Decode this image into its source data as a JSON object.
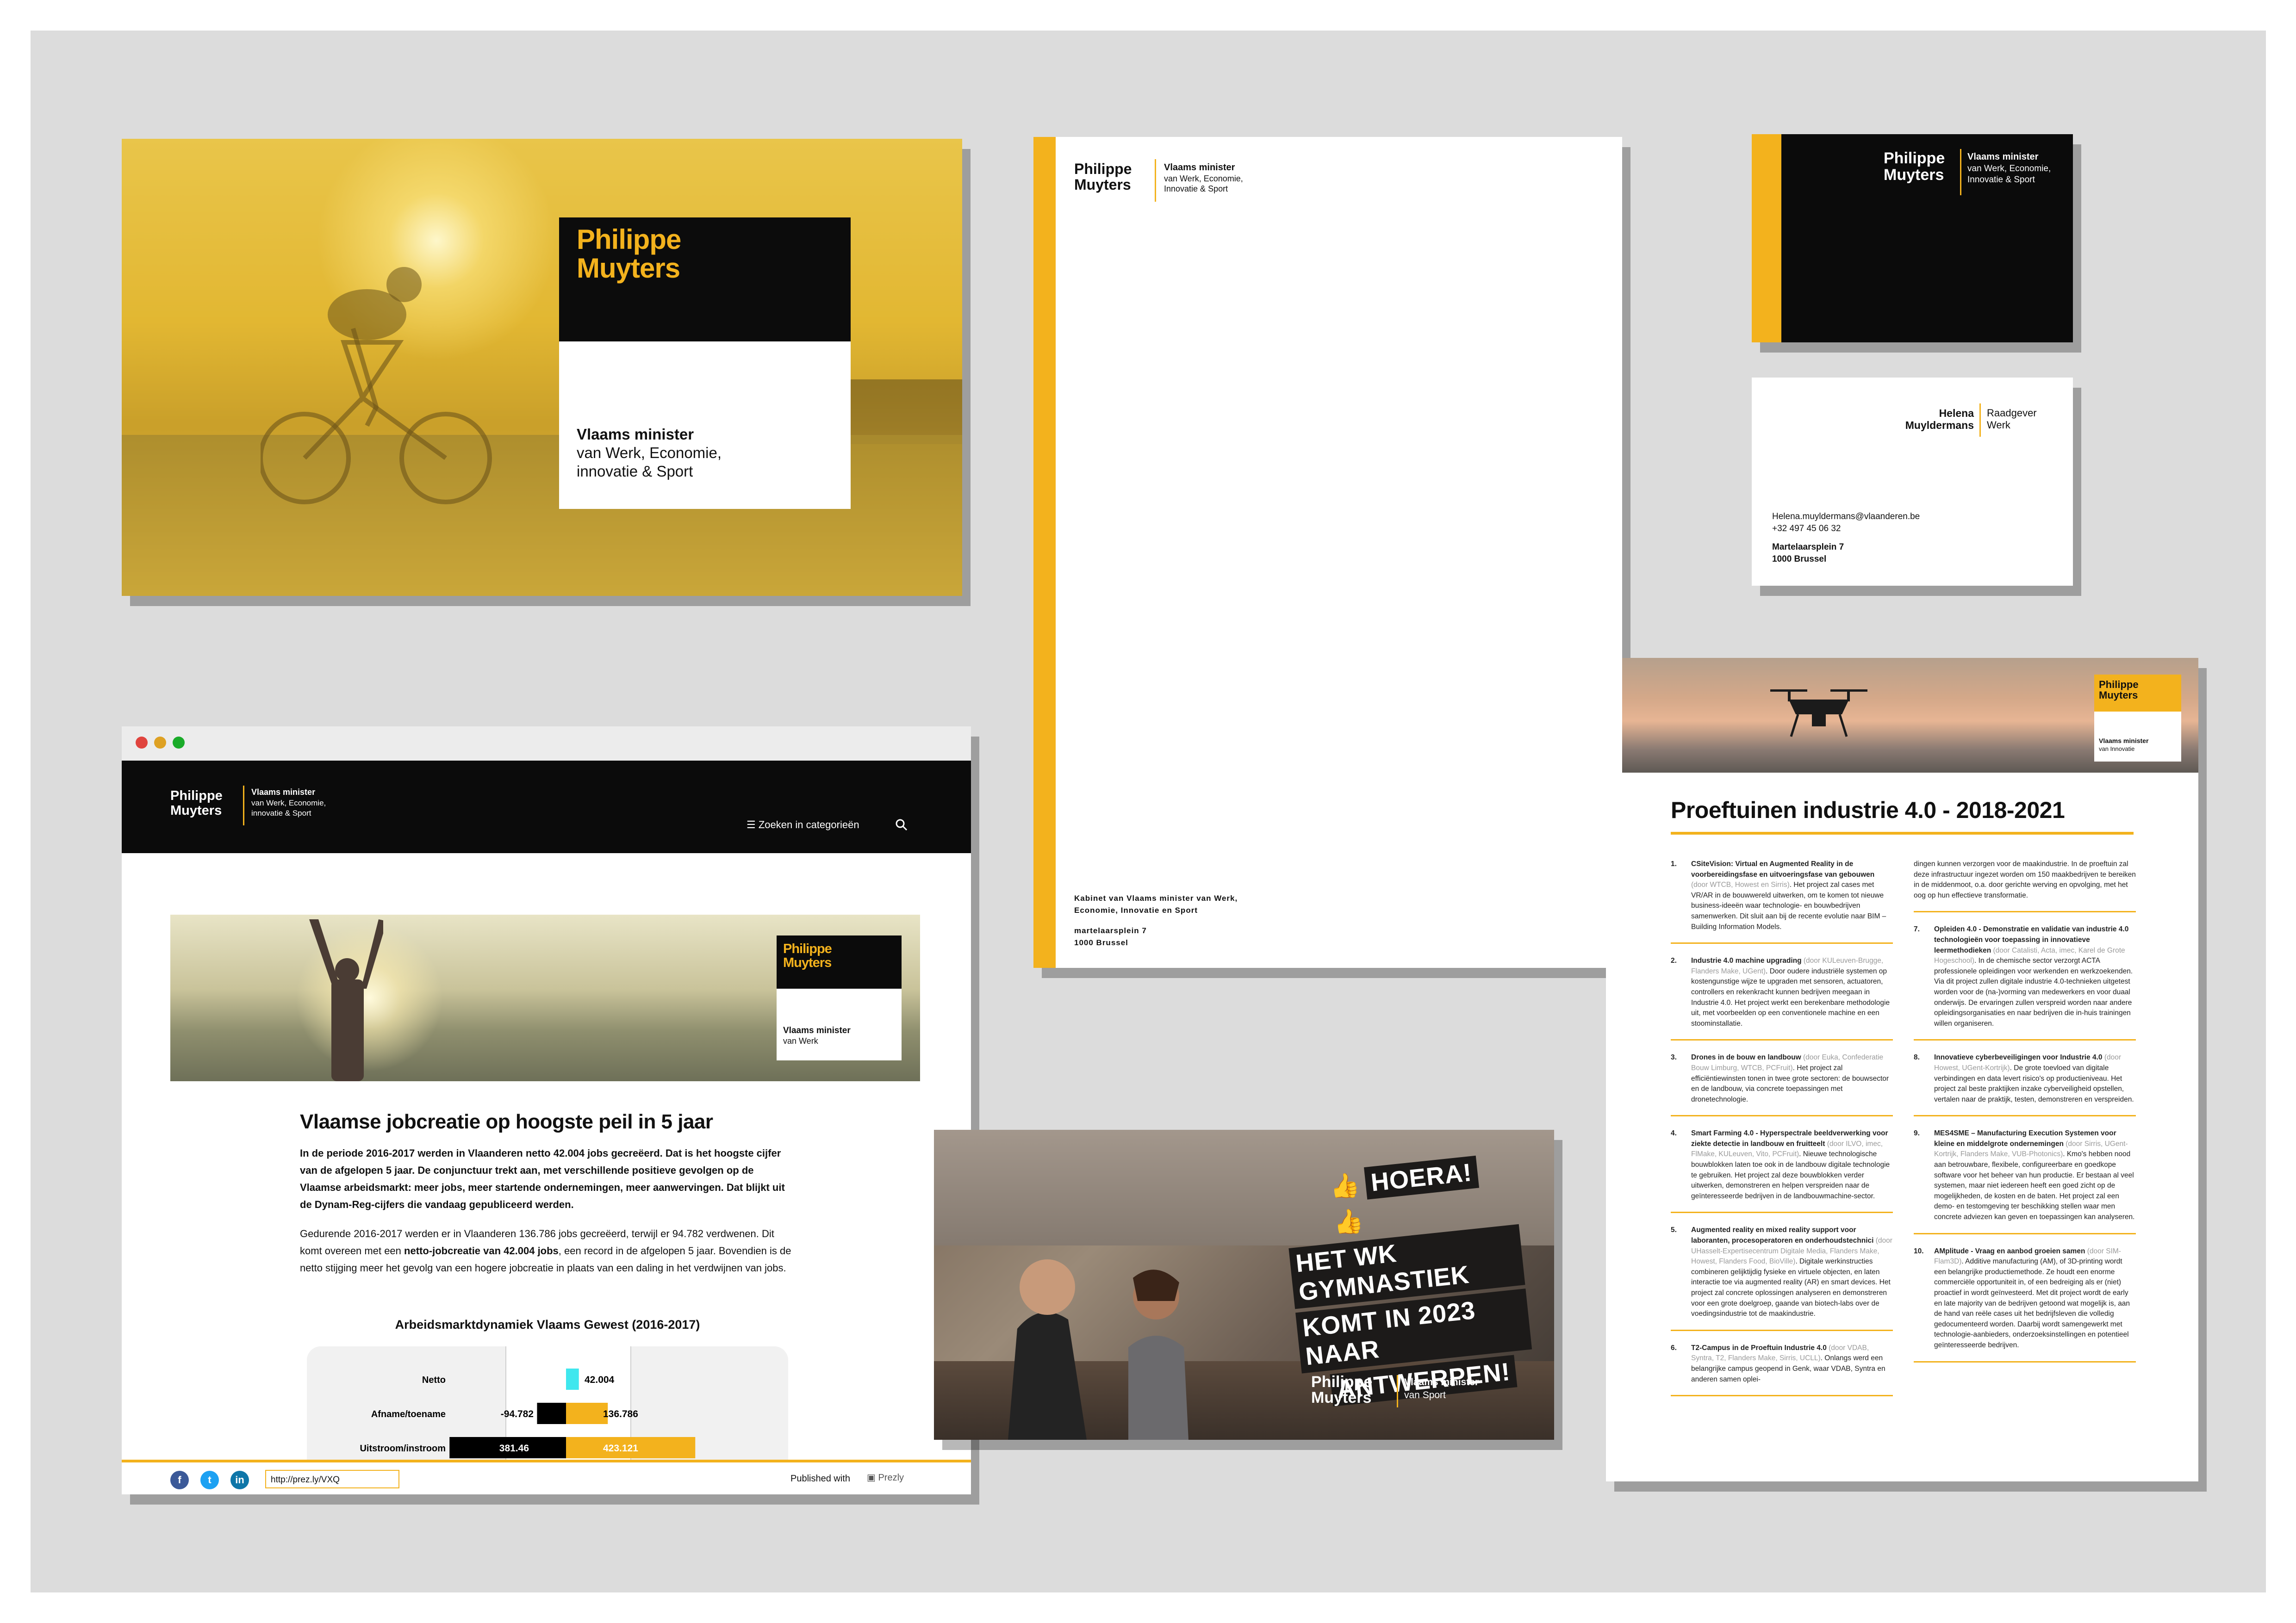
{
  "brand": {
    "name_line1": "Philippe",
    "name_line2": "Muyters",
    "accent": "#f3b21d",
    "black": "#0b0b0b"
  },
  "banner": {
    "title1": "Philippe",
    "title2": "Muyters",
    "role": "Vlaams minister",
    "sub1": "van Werk, Economie,",
    "sub2": "innovatie & Sport"
  },
  "letterhead": {
    "name1": "Philippe",
    "name2": "Muyters",
    "role": "Vlaams minister",
    "sub1": "van Werk, Economie,",
    "sub2": "Innovatie & Sport",
    "addr1": "Kabinet van Vlaams minister van Werk,",
    "addr2": "Economie, Innovatie en Sport",
    "addr3": "martelaarsplein 7",
    "addr4": "1000 Brussel"
  },
  "card_black": {
    "name1": "Philippe",
    "name2": "Muyters",
    "role": "Vlaams minister",
    "sub1": "van Werk, Economie,",
    "sub2": "Innovatie & Sport"
  },
  "card_white": {
    "name1": "Helena",
    "name2": "Muyldermans",
    "role1": "Raadgever",
    "role2": "Werk",
    "email": "Helena.muyldermans@vlaanderen.be",
    "phone": "+32 497 45 06 32",
    "addr1": "Martelaarsplein 7",
    "addr2": "1000 Brussel"
  },
  "browser": {
    "nav": {
      "name1": "Philippe",
      "name2": "Muyters",
      "role": "Vlaams minister",
      "sub1": "van Werk, Economie,",
      "sub2": "innovatie & Sport",
      "search_label": "Zoeken in categorieën"
    },
    "hero": {
      "name1": "Philippe",
      "name2": "Muyters",
      "role": "Vlaams minister",
      "sub": "van Werk"
    },
    "article": {
      "title": "Vlaamse jobcreatie op hoogste peil in 5 jaar",
      "lead": "In de periode 2016-2017 werden in Vlaanderen netto 42.004 jobs gecreëerd. Dat is het hoogste cijfer van de afgelopen 5 jaar. De conjunctuur trekt aan, met verschillende positieve gevolgen op de Vlaamse arbeidsmarkt: meer jobs, meer startende ondernemingen, meer aanwervingen. Dat blijkt uit de Dynam-Reg-cijfers die vandaag gepubliceerd werden.",
      "body_a": "Gedurende 2016-2017 werden er in Vlaanderen 136.786 jobs gecreëerd, terwijl er 94.782 verdwenen. Dit komt overeen met een ",
      "body_b": "netto-jobcreatie van 42.004 jobs",
      "body_c": ", een record in de afgelopen 5 jaar. Bovendien is de netto stijging meer het gevolg van een hogere jobcreatie in plaats van een daling in het verdwijnen van jobs."
    },
    "footer": {
      "url": "http://prez.ly/VXQ",
      "published": "Published with",
      "provider": "Prezly"
    }
  },
  "chart_data": {
    "type": "bar",
    "title": "Arbeidsmarktdynamiek Vlaams Gewest (2016-2017)",
    "categories": [
      "Netto",
      "Afname/toename",
      "Uitstroom/instroom"
    ],
    "series": [
      {
        "values": [
          42.004,
          136.786,
          423.121
        ]
      },
      {
        "values": [
          0,
          -94.782,
          -381.46
        ]
      }
    ],
    "labels": [
      "42.004",
      "-94.782",
      "136.786",
      "381.46",
      "423.121"
    ],
    "colors": [
      "#3fe7ee",
      "#f3b21d",
      "#000000"
    ]
  },
  "gym": {
    "line1": "HOERA!",
    "line2": "HET WK GYMNASTIEK",
    "line3": "KOMT IN 2023 NAAR",
    "line4": "ANTWERPEN!",
    "name1": "Philippe",
    "name2": "Muyters",
    "role": "Vlaams minister",
    "sub": "van Sport"
  },
  "brochure": {
    "logo1": "Philippe",
    "logo2": "Muyters",
    "logo_role": "Vlaams minister",
    "logo_sub": "van Innovatie",
    "title": "Proeftuinen industrie 4.0 - 2018-2021",
    "left": [
      {
        "num": "1.",
        "title": "CSiteVision: Virtual en Augmented Reality in de voorbereidingsfase en uitvoeringsfase van gebouwen",
        "by": " (door WTCB, Howest en Sirris)",
        "body": ". Het project zal cases met VR/AR in de bouwwereld uitwerken, om te komen tot nieuwe business-ideeën waar technologie- en bouwbedrijven samenwerken. Dit sluit aan bij de recente evolutie naar BIM – Building Information Models."
      },
      {
        "num": "2.",
        "title": "Industrie 4.0 machine upgrading",
        "by": " (door KULeuven-Brugge, Flanders Make, UGent)",
        "body": ". Door oudere industriële systemen op kostengunstige wijze te upgraden met sensoren, actuatoren, controllers en rekenkracht kunnen bedrijven meegaan in Industrie 4.0. Het project werkt een berekenbare methodologie uit, met voorbeelden op een conventionele machine en een stoominstallatie."
      },
      {
        "num": "3.",
        "title": "Drones in de bouw en landbouw",
        "by": " (door Euka, Confederatie Bouw Limburg, WTCB, PCFruit)",
        "body": ". Het project zal efficiëntiewinsten tonen in twee grote sectoren: de bouwsector en de landbouw, via concrete toepassingen met dronetechnologie."
      },
      {
        "num": "4.",
        "title": "Smart Farming 4.0 - Hyperspectrale beeldverwerking voor ziekte detectie in landbouw en fruitteelt",
        "by": " (door ILVO, imec, FlMake, KULeuven, Vito, PCFruit)",
        "body": ". Nieuwe technologische bouwblokken laten toe ook in de landbouw digitale technologie te gebruiken. Het project zal deze bouwblokken verder uitwerken, demonstreren en helpen verspreiden naar de geïnteresseerde bedrijven in de landbouwmachine-sector."
      },
      {
        "num": "5.",
        "title": "Augmented reality en mixed reality support voor laboranten, procesoperatoren en onderhoudstechnici",
        "by": " (door UHasselt-Expertisecentrum Digitale Media, Flanders Make, Howest, Flanders Food, BioVille)",
        "body": ". Digitale werkinstructies combineren gelijktijdig fysieke en virtuele objecten, en laten interactie toe via augmented reality (AR) en smart devices. Het project zal concrete oplossingen analyseren en demonstreren voor een grote doelgroep, gaande van biotech-labs over de voedingsindustrie tot de maakindustrie."
      },
      {
        "num": "6.",
        "title": "T2-Campus in de Proeftuin Industrie 4.0",
        "by": " (door VDAB, Syntra, T2, Flanders Make, Sirris, UCLL)",
        "body": ". Onlangs werd een belangrijke campus geopend in Genk, waar VDAB, Syntra en anderen samen oplei-"
      }
    ],
    "right_intro": "dingen kunnen verzorgen voor de maakindustrie. In de proeftuin zal deze infrastructuur ingezet worden om 150 maakbedrijven te bereiken in de middenmoot, o.a. door gerichte werving en opvolging, met het oog op hun effectieve transformatie.",
    "right": [
      {
        "num": "7.",
        "title": "Opleiden 4.0 - Demonstratie en validatie van industrie 4.0 technologieën voor toepassing in innovatieve leermethodieken",
        "by": " (door Catalisti, Acta, imec, Karel de Grote Hogeschool)",
        "body": ". In de chemische sector verzorgt ACTA professionele opleidingen voor werkenden en werkzoekenden. Via dit project zullen digitale industrie 4.0-technieken uitgetest worden voor de (na-)vorming van medewerkers en voor duaal onderwijs. De ervaringen zullen verspreid worden naar andere opleidingsorganisaties en naar bedrijven die in-huis trainingen willen organiseren."
      },
      {
        "num": "8.",
        "title": "Innovatieve cyberbeveiligingen voor Industrie 4.0",
        "by": " (door Howest, UGent-Kortrijk)",
        "body": ". De grote toevloed van digitale verbindingen en data levert risico's op productieniveau. Het project zal beste praktijken inzake cyberveiligheid opstellen, vertalen naar de praktijk, testen, demonstreren en verspreiden."
      },
      {
        "num": "9.",
        "title": "MES4SME – Manufacturing Execution Systemen voor kleine en middelgrote ondernemingen",
        "by": " (door Sirris, UGent-Kortrijk, Flanders Make, VUB-Photonics)",
        "body": ". Kmo's hebben nood aan betrouwbare, flexibele, configureerbare en goedkope software voor het beheer van hun productie. Er bestaan al veel systemen, maar niet iedereen heeft een goed zicht op de mogelijkheden, de kosten en de baten. Het project zal een demo- en testomgeving ter beschikking stellen waar men concrete adviezen kan geven en toepassingen kan analyseren."
      },
      {
        "num": "10.",
        "title": "AMplitude - Vraag en aanbod groeien samen",
        "by": " (door SIM-Flam3D)",
        "body": ". Additive manufacturing (AM), of 3D-printing wordt een belangrijke productiemethode. Ze houdt een enorme commerciële opportuniteit in, of een bedreiging als er (niet) proactief in wordt geïnvesteerd. Met dit project wordt de early en late majority van de bedrijven getoond wat mogelijk is, aan de hand van reële cases uit het bedrijfsleven die volledig gedocumenteerd worden. Daarbij wordt samengewerkt met technologie-aanbieders, onderzoeksinstellingen en potentieel geïnteresseerde bedrijven."
      }
    ]
  }
}
